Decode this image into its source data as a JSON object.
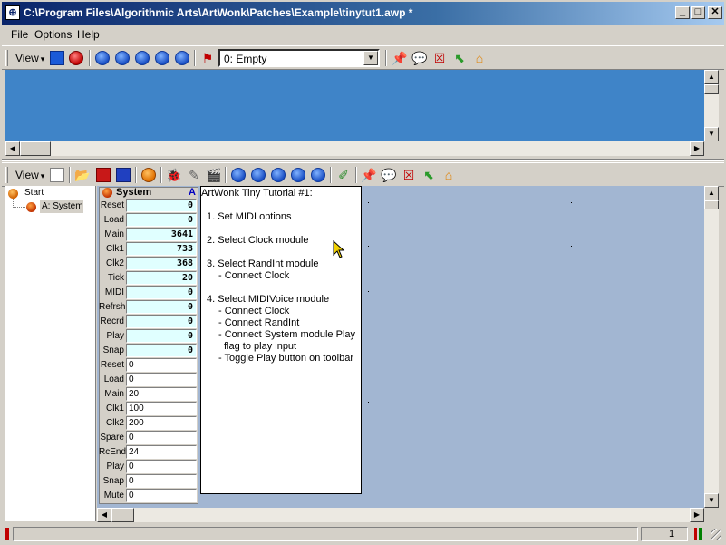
{
  "window": {
    "title": "C:\\Program Files\\Algorithmic Arts\\ArtWonk\\Patches\\Example\\tinytut1.awp *",
    "app_icon": "artwonk-icon",
    "minimize": "_",
    "maximize": "□",
    "close": "✕"
  },
  "menu": [
    "File",
    "Options",
    "Help"
  ],
  "toolbar_top": {
    "view_label": "View",
    "view_arrow": "▾",
    "combo_value": "0: Empty",
    "combo_arrow": "▼"
  },
  "toolbar_bottom": {
    "view_label": "View",
    "view_arrow": "▾"
  },
  "tree": {
    "root": "Start",
    "child": "A: System"
  },
  "module": {
    "title": "System",
    "tag": "A",
    "outputs": [
      {
        "label": "Reset",
        "value": "0"
      },
      {
        "label": "Load",
        "value": "0"
      },
      {
        "label": "Main",
        "value": "3641"
      },
      {
        "label": "Clk1",
        "value": "733"
      },
      {
        "label": "Clk2",
        "value": "368"
      },
      {
        "label": "Tick",
        "value": "20"
      },
      {
        "label": "MIDI",
        "value": "0"
      },
      {
        "label": "Refrsh",
        "value": "0"
      },
      {
        "label": "Recrd",
        "value": "0"
      },
      {
        "label": "Play",
        "value": "0"
      },
      {
        "label": "Snap",
        "value": "0"
      }
    ],
    "inputs": [
      {
        "label": "Reset",
        "value": "0"
      },
      {
        "label": "Load",
        "value": "0"
      },
      {
        "label": "Main",
        "value": "20"
      },
      {
        "label": "Clk1",
        "value": "100"
      },
      {
        "label": "Clk2",
        "value": "200"
      },
      {
        "label": "Spare",
        "value": "0"
      },
      {
        "label": "RcEnd",
        "value": "24"
      },
      {
        "label": "Play",
        "value": "0"
      },
      {
        "label": "Snap",
        "value": "0"
      },
      {
        "label": "Mute",
        "value": "0"
      }
    ]
  },
  "note": {
    "title": "ArtWonk Tiny Tutorial #1:",
    "lines": [
      "1.  Set MIDI options",
      "2.  Select Clock module",
      "3.  Select RandInt module",
      "- Connect Clock",
      "4.  Select MIDIVoice module",
      "- Connect Clock",
      "- Connect RandInt",
      "- Connect System module Play",
      "flag to play input",
      "- Toggle Play button on toolbar"
    ]
  },
  "statusbar": {
    "value": "1"
  },
  "colors": {
    "upper_canvas": "#3f84c8",
    "lower_canvas": "#a2b6d2",
    "title_gradient_start": "#0a246a"
  }
}
